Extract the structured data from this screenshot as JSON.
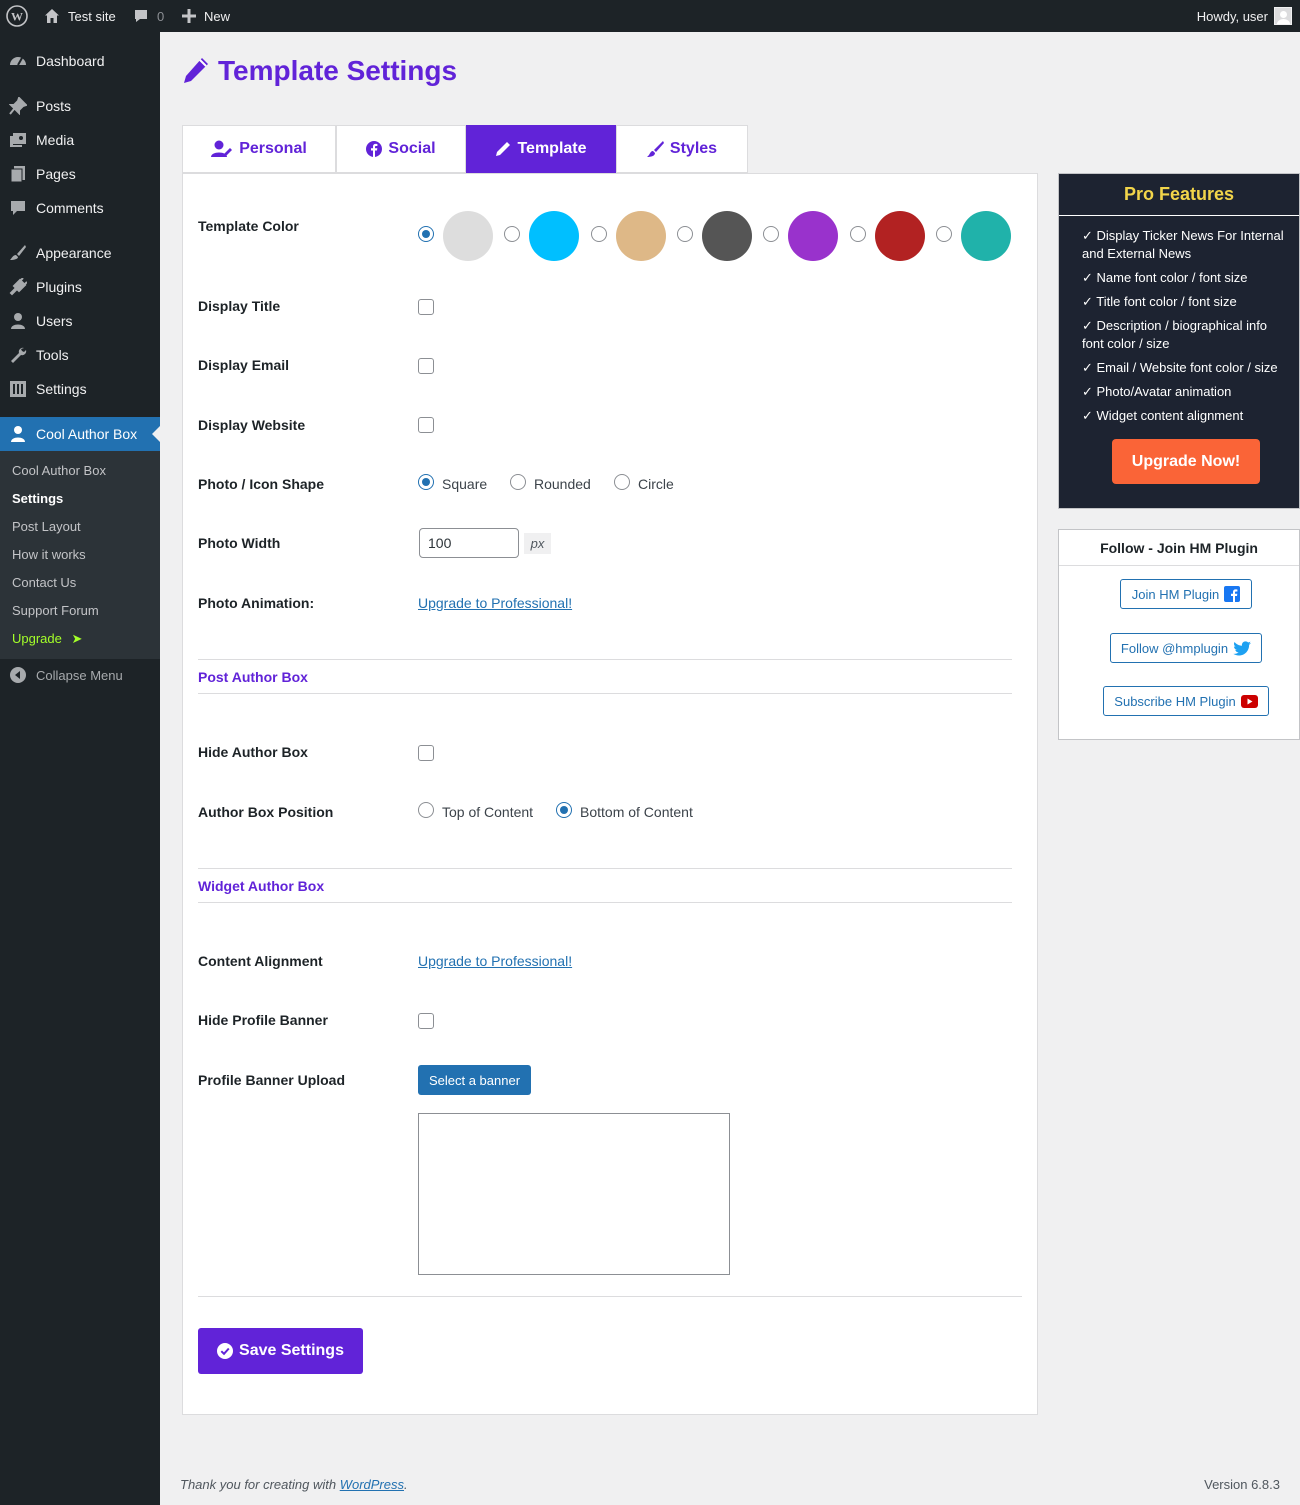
{
  "adminbar": {
    "site_name": "Test site",
    "comments_count": "0",
    "new_label": "New",
    "greeting": "Howdy, user"
  },
  "sidebar": {
    "items": [
      {
        "label": "Dashboard",
        "icon": "dashboard-icon"
      },
      {
        "label": "Posts",
        "icon": "pin-icon"
      },
      {
        "label": "Media",
        "icon": "media-icon"
      },
      {
        "label": "Pages",
        "icon": "pages-icon"
      },
      {
        "label": "Comments",
        "icon": "comment-icon"
      },
      {
        "label": "Appearance",
        "icon": "brush-icon"
      },
      {
        "label": "Plugins",
        "icon": "plugin-icon"
      },
      {
        "label": "Users",
        "icon": "user-icon"
      },
      {
        "label": "Tools",
        "icon": "wrench-icon"
      },
      {
        "label": "Settings",
        "icon": "settings-icon"
      },
      {
        "label": "Cool Author Box",
        "icon": "author-icon"
      }
    ],
    "submenu": [
      "Cool Author Box",
      "Settings",
      "Post Layout",
      "How it works",
      "Contact Us",
      "Support Forum",
      "Upgrade"
    ],
    "upgrade_arrow": "➤",
    "collapse_label": "Collapse Menu"
  },
  "page_title": "Template Settings",
  "tabs": [
    {
      "label": "Personal",
      "active": false
    },
    {
      "label": "Social",
      "active": false
    },
    {
      "label": "Template",
      "active": true
    },
    {
      "label": "Styles",
      "active": false
    }
  ],
  "form": {
    "template_color_label": "Template Color",
    "template_colors": [
      "#dddddd",
      "#00bfff",
      "#deb887",
      "#555555",
      "#9932cc",
      "#b22222",
      "#20b2aa"
    ],
    "selected_color_index": 0,
    "display_title_label": "Display Title",
    "display_email_label": "Display Email",
    "display_website_label": "Display Website",
    "photo_shape_label": "Photo / Icon Shape",
    "photo_shape_options": [
      "Square",
      "Rounded",
      "Circle"
    ],
    "photo_shape_selected": "Square",
    "photo_width_label": "Photo Width",
    "photo_width_value": "100",
    "photo_width_unit": "px",
    "photo_animation_label": "Photo Animation:",
    "upgrade_link": "Upgrade to Professional!",
    "post_author_box_title": "Post Author Box",
    "hide_author_box_label": "Hide Author Box",
    "author_box_position_label": "Author Box Position",
    "author_box_position_options": [
      "Top of Content",
      "Bottom of Content"
    ],
    "author_box_position_selected": "Bottom of Content",
    "widget_author_box_title": "Widget Author Box",
    "content_alignment_label": "Content Alignment",
    "hide_profile_banner_label": "Hide Profile Banner",
    "profile_banner_upload_label": "Profile Banner Upload",
    "select_banner_button": "Select a banner",
    "save_button": "Save Settings"
  },
  "pro_features": {
    "title": "Pro Features",
    "items": [
      "✓ Display Ticker News For Internal and External News",
      "✓ Name font color / font size",
      "✓ Title font color / font size",
      "✓ Description / biographical info font color / size",
      "✓ Email / Website font color / size",
      "✓ Photo/Avatar animation",
      "✓ Widget content alignment"
    ],
    "upgrade_button": "Upgrade Now!"
  },
  "follow": {
    "title": "Follow - Join HM Plugin",
    "buttons": [
      "Join HM Plugin",
      "Follow @hmplugin",
      "Subscribe HM Plugin"
    ]
  },
  "footer": {
    "thanks_prefix": "Thank you for creating with ",
    "thanks_link": "WordPress",
    "thanks_suffix": ".",
    "version": "Version 6.8.3"
  }
}
